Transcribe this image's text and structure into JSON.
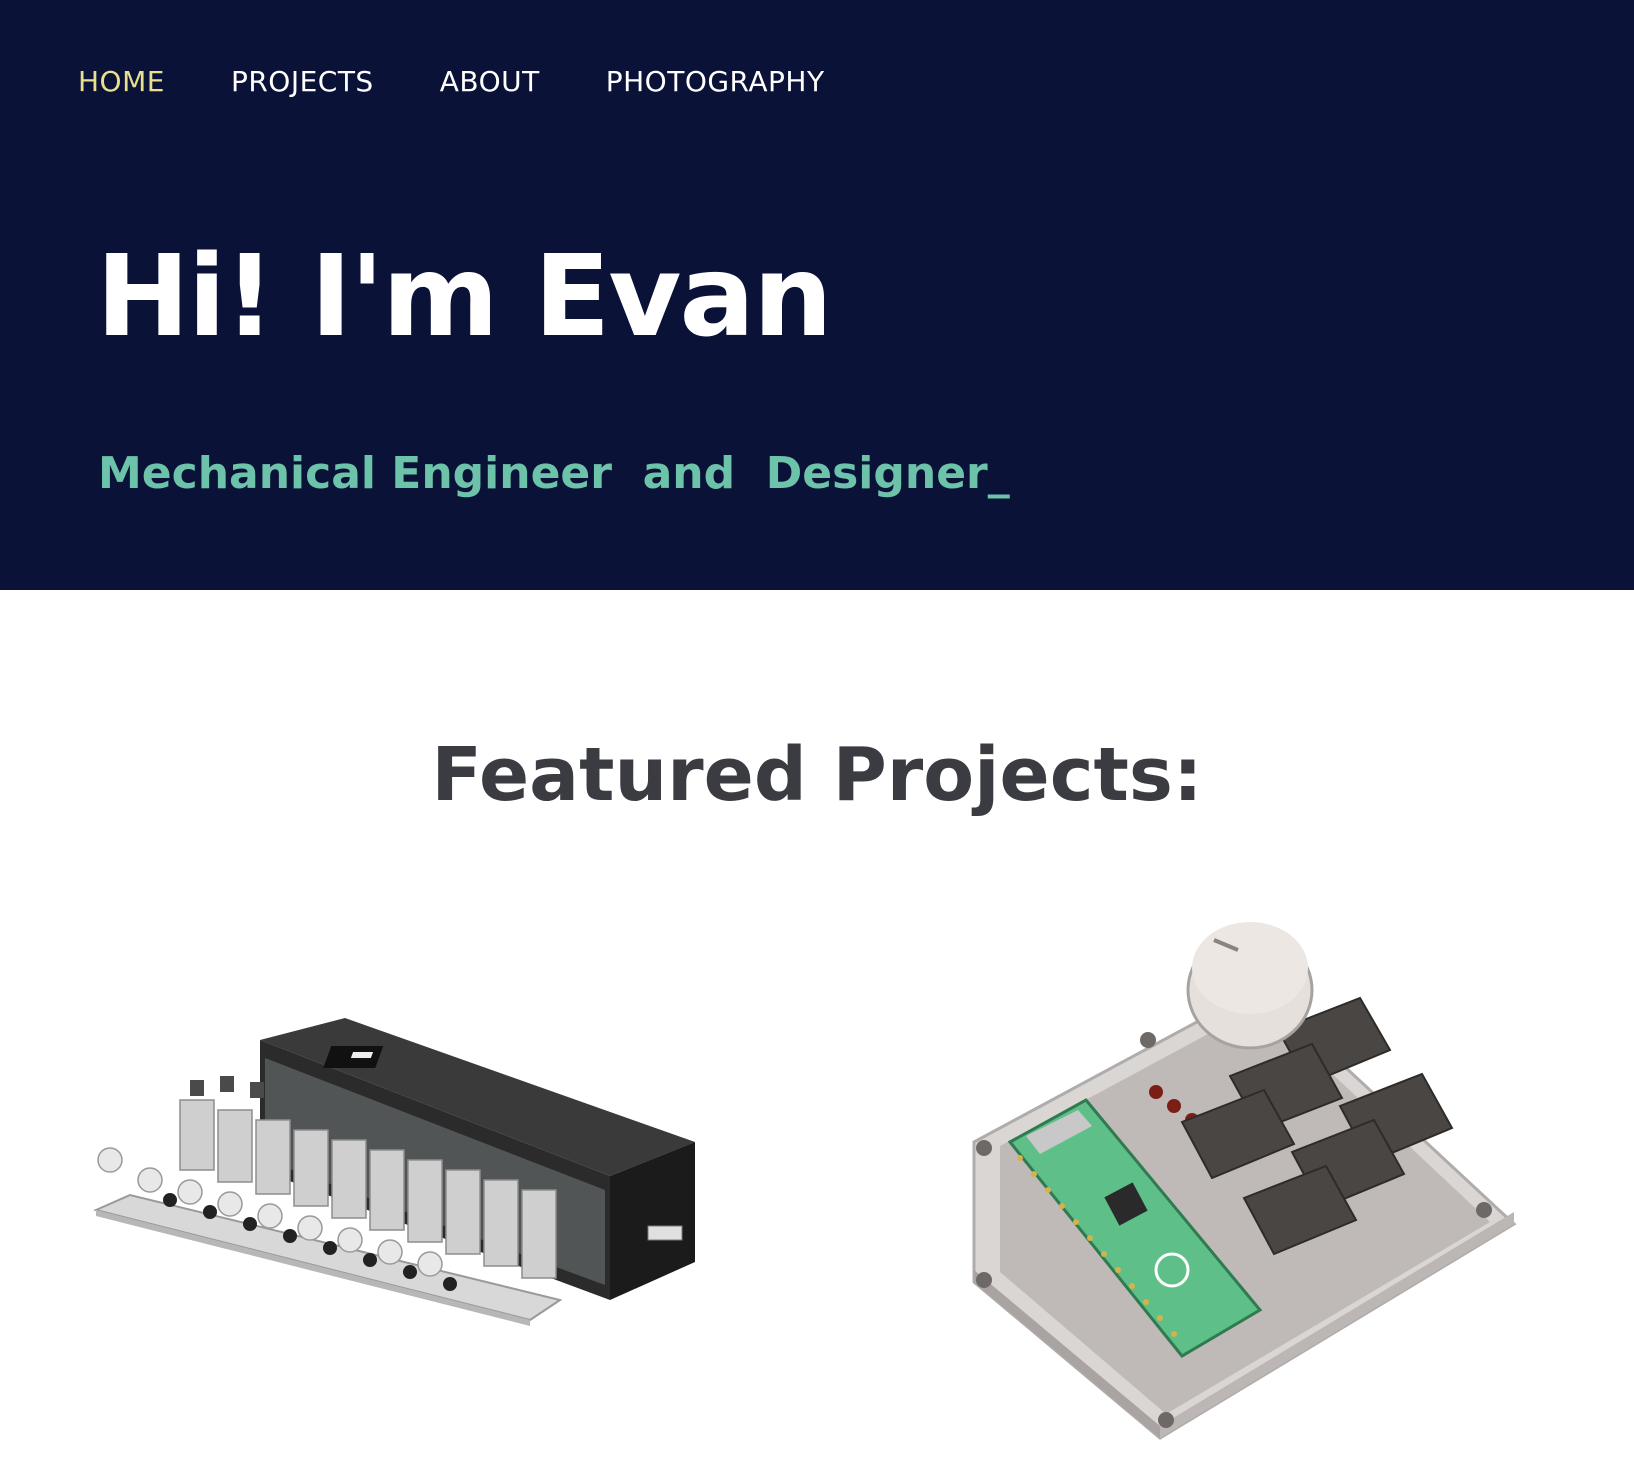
{
  "nav": {
    "items": [
      {
        "label": "HOME",
        "active": true
      },
      {
        "label": "PROJECTS",
        "active": false
      },
      {
        "label": "ABOUT",
        "active": false
      },
      {
        "label": "PHOTOGRAPHY",
        "active": false
      }
    ]
  },
  "hero": {
    "title": "Hi! I'm Evan",
    "subtitle": "Mechanical Engineer  and  Designer_"
  },
  "featured": {
    "title": "Featured Projects:"
  },
  "colors": {
    "hero_bg": "#0b1238",
    "nav_active": "#e9df8e",
    "nav_text": "#ffffff",
    "subtitle": "#6cc3aa",
    "section_title": "#3b3c42"
  },
  "projects": [
    {
      "image": "mechanical-assembly-render"
    },
    {
      "image": "macropad-render"
    }
  ]
}
